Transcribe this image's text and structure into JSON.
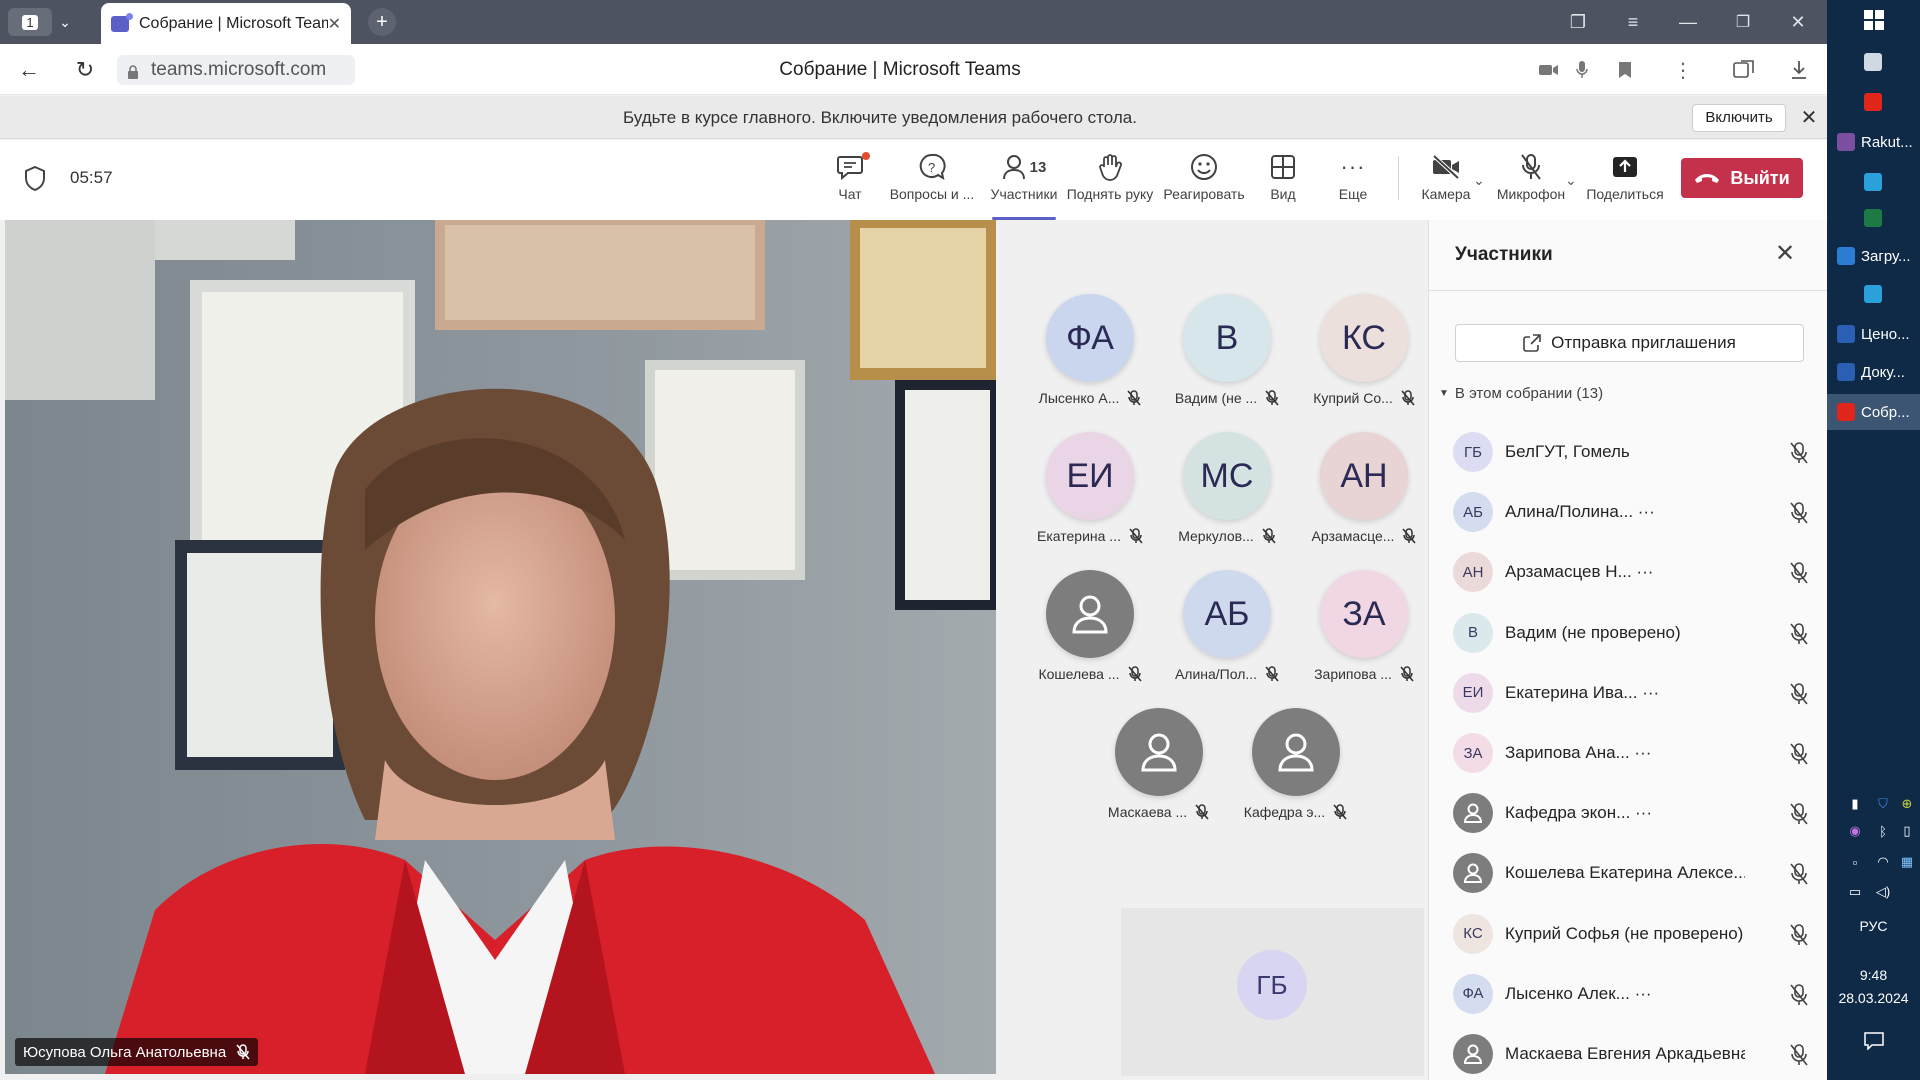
{
  "browser": {
    "tab_count": "1",
    "tab_title": "Собрание | Microsoft Teams",
    "url": "teams.microsoft.com",
    "page_title": "Собрание | Microsoft Teams"
  },
  "notification": {
    "text": "Будьте в курсе главного. Включите уведомления рабочего стола.",
    "enable_label": "Включить"
  },
  "meeting": {
    "timer": "05:57",
    "toolbar": [
      {
        "id": "chat",
        "label": "Чат",
        "icon": "chat-icon",
        "badge": true
      },
      {
        "id": "qa",
        "label": "Вопросы и ...",
        "icon": "qa-icon"
      },
      {
        "id": "participants",
        "label": "Участники",
        "icon": "people-icon",
        "count": "13",
        "active": true
      },
      {
        "id": "raise-hand",
        "label": "Поднять руку",
        "icon": "hand-icon"
      },
      {
        "id": "react",
        "label": "Реагировать",
        "icon": "emoji-icon"
      },
      {
        "id": "view",
        "label": "Вид",
        "icon": "grid-icon"
      },
      {
        "id": "more",
        "label": "Еще",
        "icon": "more-icon"
      },
      {
        "id": "camera",
        "label": "Камера",
        "icon": "camera-off-icon"
      },
      {
        "id": "mic",
        "label": "Микрофон",
        "icon": "mic-off-icon"
      },
      {
        "id": "share",
        "label": "Поделиться",
        "icon": "share-icon"
      }
    ],
    "leave_label": "Выйти",
    "speaker_name": "Юсупова Ольга Анатольевна"
  },
  "grid_tiles": [
    {
      "initials": "ФА",
      "name": "Лысенко А...",
      "color": "#c9d6ee"
    },
    {
      "initials": "В",
      "name": "Вадим (не ...",
      "color": "#d6e6ea"
    },
    {
      "initials": "КС",
      "name": "Куприй Со...",
      "color": "#ebe0dc"
    },
    {
      "initials": "ЕИ",
      "name": "Екатерина ...",
      "color": "#ead5e6"
    },
    {
      "initials": "МС",
      "name": "Меркулов...",
      "color": "#d4e2e2"
    },
    {
      "initials": "АН",
      "name": "Арзамасце...",
      "color": "#e8d3d5"
    },
    {
      "initials": "",
      "name": "Кошелева ...",
      "color": "#7d7d7d",
      "person": true
    },
    {
      "initials": "АБ",
      "name": "Алина/Пол...",
      "color": "#cfd9ed"
    },
    {
      "initials": "ЗА",
      "name": "Зарипова ...",
      "color": "#f1d6e3"
    },
    {
      "initials": "",
      "name": "Маскаева ...",
      "color": "#7d7d7d",
      "person": true
    },
    {
      "initials": "",
      "name": "Кафедра э...",
      "color": "#7d7d7d",
      "person": true
    }
  ],
  "self_tile": {
    "initials": "ГБ"
  },
  "participants_panel": {
    "title": "Участники",
    "invite_label": "Отправка приглашения",
    "section_label": "В этом собрании (13)",
    "items": [
      {
        "initials": "ГБ",
        "name": "БелГУТ, Гомель",
        "color": "#dcdcf3"
      },
      {
        "initials": "АБ",
        "name": "Алина/Полина... ···",
        "color": "#d3ddef"
      },
      {
        "initials": "АН",
        "name": "Арзамасцев Н... ···",
        "color": "#ecd9da"
      },
      {
        "initials": "В",
        "name": "Вадим (не проверено)",
        "color": "#dbe8ec"
      },
      {
        "initials": "ЕИ",
        "name": "Екатерина Ива... ···",
        "color": "#eedbea"
      },
      {
        "initials": "ЗА",
        "name": "Зарипова Ана... ···",
        "color": "#f3dce7"
      },
      {
        "initials": "",
        "name": "Кафедра экон... ···",
        "color": "#7d7d7d",
        "person": true
      },
      {
        "initials": "",
        "name": "Кошелева Екатерина Алексе...",
        "color": "#7d7d7d",
        "person": true
      },
      {
        "initials": "КС",
        "name": "Куприй Софья (не проверено)",
        "color": "#eee5e1"
      },
      {
        "initials": "ФА",
        "name": "Лысенко Алек... ···",
        "color": "#d3ddef"
      },
      {
        "initials": "",
        "name": "Маскаева Евгения Аркадьевна",
        "color": "#7d7d7d",
        "person": true
      }
    ]
  },
  "taskbar": {
    "items": [
      {
        "label": "",
        "color": "#cfd8e3"
      },
      {
        "label": "",
        "color": "#e0261b"
      },
      {
        "label": "Rakut...",
        "color": "#7b4fa0"
      },
      {
        "label": "",
        "color": "#2aa1da"
      },
      {
        "label": "",
        "color": "#1e7a45"
      },
      {
        "label": "Загру...",
        "color": "#2b7cd3"
      },
      {
        "label": "",
        "color": "#2aa1da"
      },
      {
        "label": "Ценo...",
        "color": "#2b5fb4"
      },
      {
        "label": "Доку...",
        "color": "#2b5fb4"
      },
      {
        "label": "Собр...",
        "color": "#e0261b",
        "selected": true
      }
    ],
    "language": "РУС",
    "time": "9:48",
    "date": "28.03.2024"
  }
}
